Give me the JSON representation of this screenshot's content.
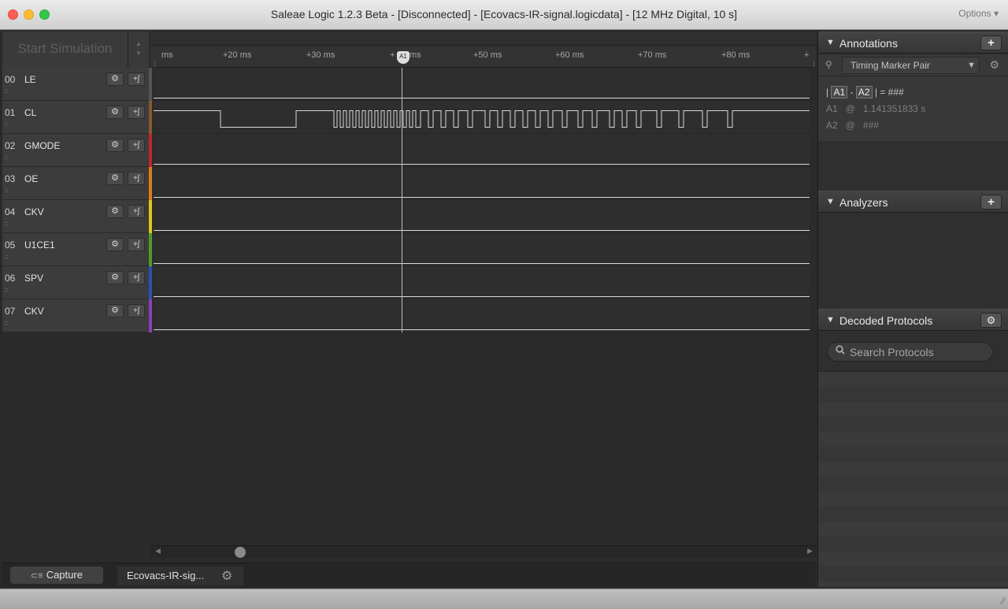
{
  "window": {
    "title": "Saleae Logic 1.2.3 Beta - [Disconnected] - [Ecovacs-IR-signal.logicdata] - [12 MHz Digital, 10 s]",
    "options_label": "Options ▾"
  },
  "toolbar": {
    "start_simulation": "Start Simulation",
    "spinner_up": "▲",
    "spinner_down": "▼"
  },
  "timeline": {
    "ticks": [
      "ms",
      "+20 ms",
      "+30 ms",
      "+",
      "ms",
      "+50 ms",
      "+60 ms",
      "+70 ms",
      "+80 ms",
      "+"
    ],
    "marker_label": "A1"
  },
  "channels": [
    {
      "num": "00",
      "name": "LE",
      "color": "#555555"
    },
    {
      "num": "01",
      "name": "CL",
      "color": "#8b5a2b"
    },
    {
      "num": "02",
      "name": "GMODE",
      "color": "#c0262b"
    },
    {
      "num": "03",
      "name": "OE",
      "color": "#e07b18"
    },
    {
      "num": "04",
      "name": "CKV",
      "color": "#e6c21a"
    },
    {
      "num": "05",
      "name": "U1CE1",
      "color": "#4f9b2a"
    },
    {
      "num": "06",
      "name": "SPV",
      "color": "#2d4fb5"
    },
    {
      "num": "07",
      "name": "CKV",
      "color": "#8e3fb5"
    }
  ],
  "channel_controls": {
    "grip": "::::",
    "gear": "⚙",
    "add": "+ʃ"
  },
  "scrollbar": {
    "left_arrow": "◀",
    "right_arrow": "▶"
  },
  "tabs": {
    "capture": "Capture",
    "capture_icon": "⊂≡",
    "file": "Ecovacs-IR-sig...",
    "settings_icon": "⚙"
  },
  "annotations": {
    "title": "Annotations",
    "add": "+",
    "collapse": "▼",
    "marker_select": "Timing Marker Pair",
    "select_arrow": "▼",
    "pin_icon": "⚲",
    "gear": "⚙",
    "measure_open": "|",
    "measure_a1": "A1",
    "measure_dash": "-",
    "measure_a2": "A2",
    "measure_close": "| = ###",
    "a1_label": "A1",
    "a1_at": "@",
    "a1_value": "1.141351833 s",
    "a2_label": "A2",
    "a2_at": "@",
    "a2_value": "###"
  },
  "analyzers": {
    "title": "Analyzers",
    "add": "+",
    "collapse": "▼"
  },
  "decoded_protocols": {
    "title": "Decoded Protocols",
    "gear": "⚙",
    "collapse": "▼",
    "search_placeholder": "Search Protocols",
    "search_icon": "🔍"
  },
  "statusbar": {
    "resize_grip": "⁄⁄"
  }
}
